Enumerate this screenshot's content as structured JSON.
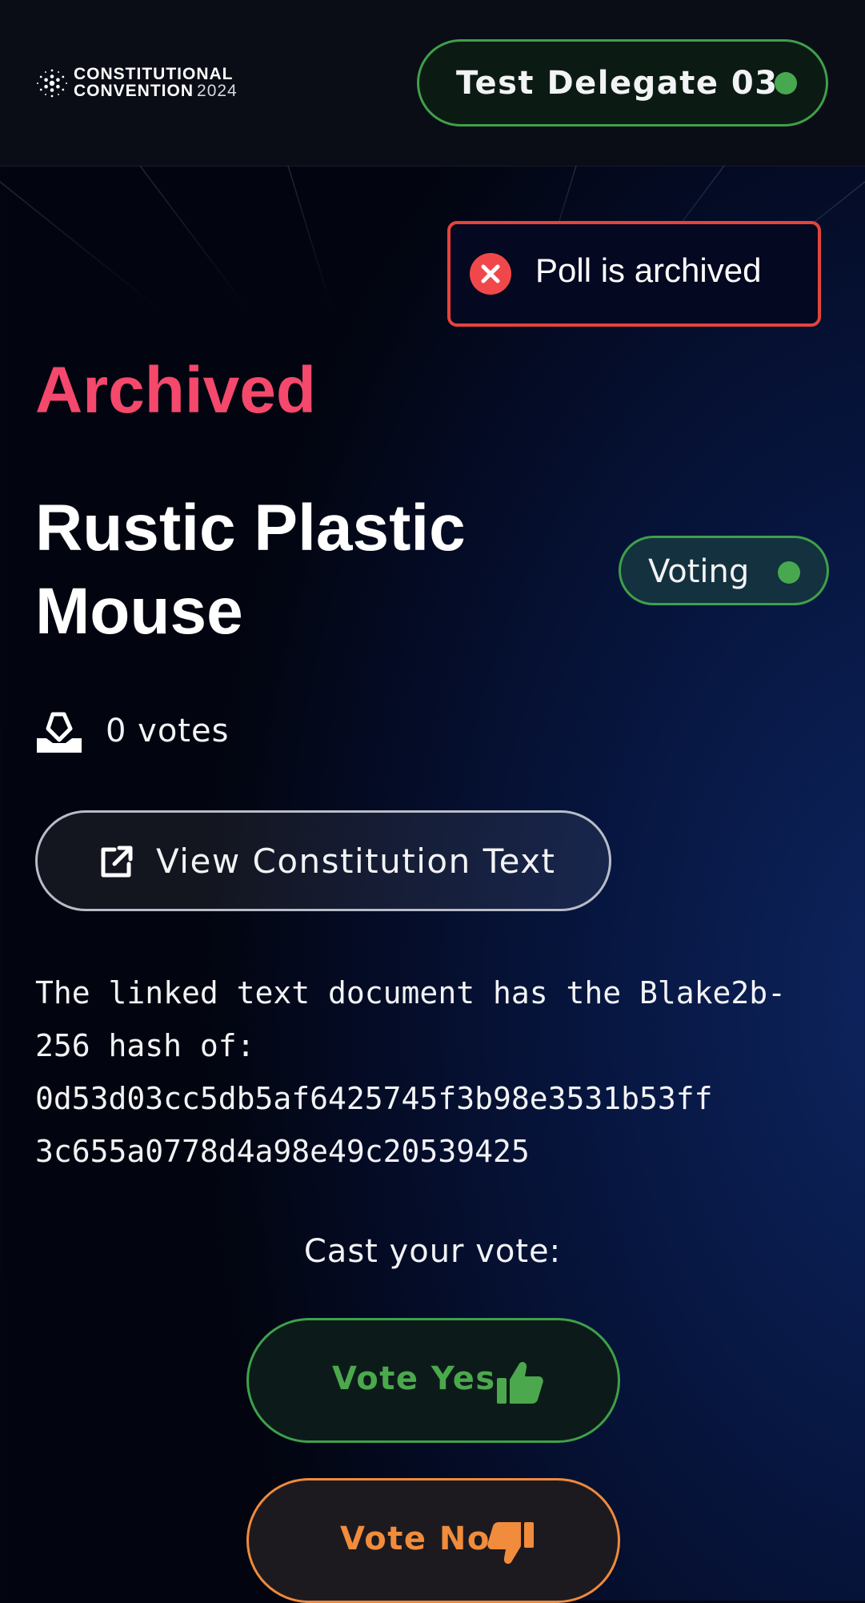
{
  "header": {
    "logo_line1": "CONSTITUTIONAL",
    "logo_line2": "CONVENTION",
    "logo_year": "2024",
    "delegate_name": "Test Delegate 03",
    "delegate_status_color": "#48a850"
  },
  "toast": {
    "message": "Poll is archived",
    "icon": "error-x-icon",
    "border_color": "#e5443b"
  },
  "poll": {
    "status_label": "Archived",
    "status_color": "#f4486c",
    "title": "Rustic Plastic Mouse",
    "phase_label": "Voting",
    "votes_text": "0 votes",
    "view_button_label": "View Constitution Text",
    "hash_lines": [
      "The linked text document has the Blake2b-",
      "256 hash of:",
      "0d53d03cc5db5af6425745f3b98e3531b53ff",
      "3c655a0778d4a98e49c20539425"
    ]
  },
  "vote": {
    "prompt": "Cast your vote:",
    "yes_label": "Vote Yes",
    "no_label": "Vote No",
    "yes_color": "#4ca84d",
    "no_color": "#f08c3c"
  }
}
